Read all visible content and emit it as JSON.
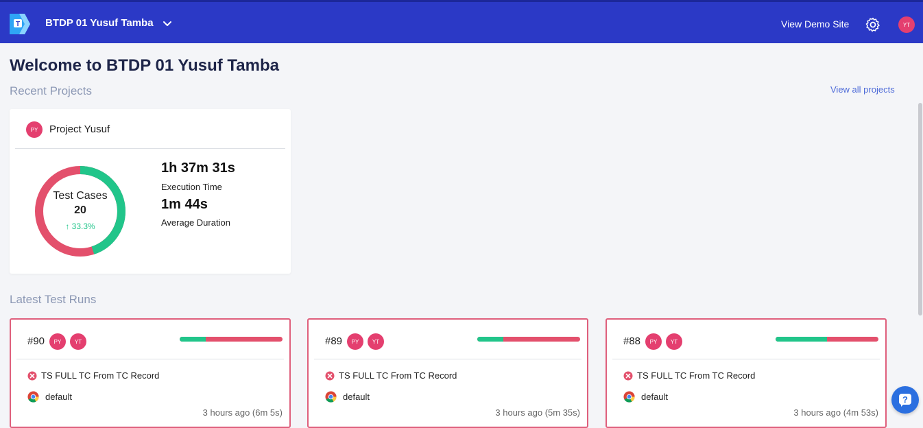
{
  "header": {
    "workspace_title": "BTDP 01 Yusuf Tamba",
    "demo_link": "View Demo Site",
    "user_initials": "YT"
  },
  "main": {
    "welcome": "Welcome to BTDP 01 Yusuf Tamba",
    "recent_projects_heading": "Recent Projects",
    "view_all_projects": "View all projects",
    "latest_runs_heading": "Latest Test Runs"
  },
  "project": {
    "initials": "PY",
    "name": "Project Yusuf",
    "donut_label": "Test Cases",
    "test_case_count": "20",
    "delta": "↑ 33.3%",
    "pass_fraction": 0.45,
    "execution_time": "1h 37m 31s",
    "execution_time_label": "Execution Time",
    "average_duration": "1m 44s",
    "average_duration_label": "Average Duration"
  },
  "runs": [
    {
      "id": "#90",
      "avatars": [
        "PY",
        "YT"
      ],
      "pass_fraction": 0.25,
      "name": "TS FULL TC From TC Record",
      "env": "default",
      "time": "3 hours ago  (6m 5s)"
    },
    {
      "id": "#89",
      "avatars": [
        "PY",
        "YT"
      ],
      "pass_fraction": 0.25,
      "name": "TS FULL TC From TC Record",
      "env": "default",
      "time": "3 hours ago  (5m 35s)"
    },
    {
      "id": "#88",
      "avatars": [
        "PY",
        "YT"
      ],
      "pass_fraction": 0.5,
      "name": "TS FULL TC From TC Record",
      "env": "default",
      "time": "3 hours ago  (4m 53s)"
    }
  ],
  "colors": {
    "header_bg": "#2b39c6",
    "pass": "#21c58a",
    "fail": "#e3506c",
    "avatar": "#e43f6f",
    "link": "#4e6bd8"
  }
}
